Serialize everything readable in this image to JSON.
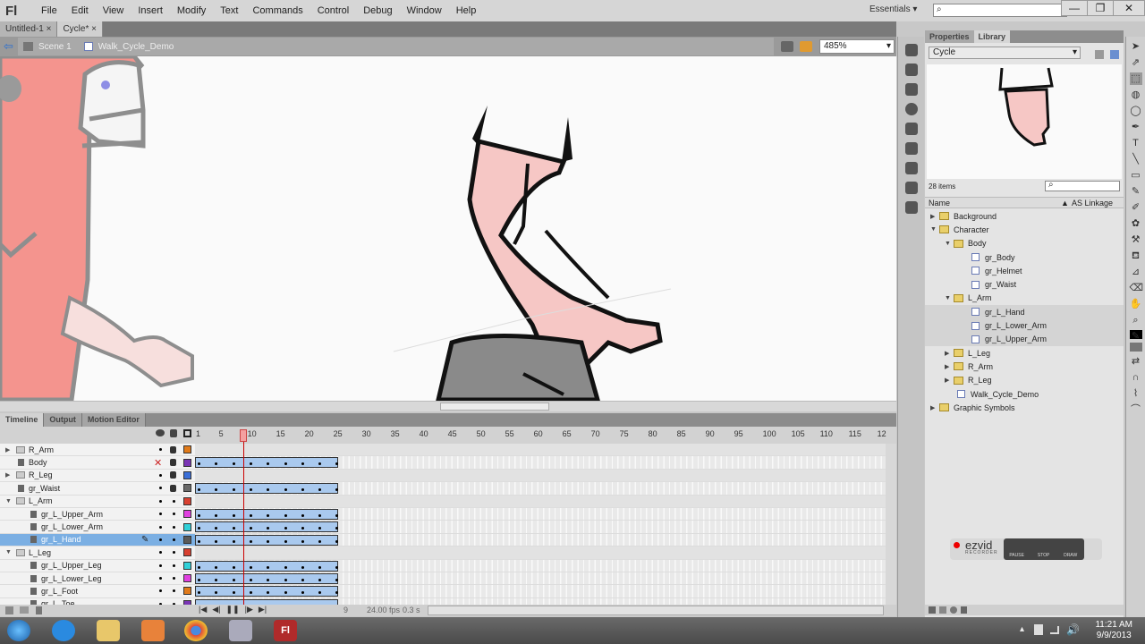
{
  "app": {
    "logo": "Fl"
  },
  "menu": [
    "File",
    "Edit",
    "View",
    "Insert",
    "Modify",
    "Text",
    "Commands",
    "Control",
    "Debug",
    "Window",
    "Help"
  ],
  "workspace": {
    "label": "Essentials",
    "chevron": "▾",
    "search_placeholder": "",
    "search_icon": "⌕"
  },
  "window_controls": {
    "minimize": "—",
    "restore": "❐",
    "close": "✕"
  },
  "doc_tabs": [
    {
      "label": "Untitled-1",
      "close": "×",
      "active": false
    },
    {
      "label": "Cycle*",
      "close": "×",
      "active": true
    }
  ],
  "edit_bar": {
    "back_icon": "⇦",
    "scene": "Scene 1",
    "symbol": "Walk_Cycle_Demo",
    "zoom": "485%",
    "zoom_chevron": "▾"
  },
  "timeline": {
    "tabs": [
      "Timeline",
      "Output",
      "Motion Editor"
    ],
    "active_tab": "Timeline",
    "header_icons": {
      "eye": "👁",
      "lock": "🔒",
      "outline": "□"
    },
    "ruler": [
      "1",
      "5",
      "10",
      "15",
      "20",
      "25",
      "30",
      "35",
      "40",
      "45",
      "50",
      "55",
      "60",
      "65",
      "70",
      "75",
      "80",
      "85",
      "90",
      "95",
      "100",
      "105",
      "110",
      "115",
      "12"
    ],
    "current_frame": 9,
    "layers": [
      {
        "name": "R_Arm",
        "type": "folder",
        "expanded": false,
        "color": "#e07a1a",
        "frames": false,
        "indent": 0
      },
      {
        "name": "Body",
        "type": "layer",
        "color": "#7a35b5",
        "frames": true,
        "indent": 0,
        "hidden": true
      },
      {
        "name": "R_Leg",
        "type": "folder",
        "expanded": false,
        "color": "#3a6fd8",
        "frames": false,
        "indent": 0
      },
      {
        "name": "gr_Waist",
        "type": "layer",
        "color": "#6a6a6a",
        "frames": true,
        "indent": 0
      },
      {
        "name": "L_Arm",
        "type": "folder",
        "expanded": true,
        "color": "#d84030",
        "frames": false,
        "indent": 0
      },
      {
        "name": "gr_L_Upper_Arm",
        "type": "layer",
        "color": "#e040e0",
        "frames": true,
        "indent": 1
      },
      {
        "name": "gr_L_Lower_Arm",
        "type": "layer",
        "color": "#30d0d8",
        "frames": true,
        "indent": 1
      },
      {
        "name": "gr_L_Hand",
        "type": "layer",
        "color": "#5a5a5a",
        "frames": true,
        "indent": 1,
        "selected": true
      },
      {
        "name": "L_Leg",
        "type": "folder",
        "expanded": true,
        "color": "#d84030",
        "frames": false,
        "indent": 0
      },
      {
        "name": "gr_L_Upper_Leg",
        "type": "layer",
        "color": "#30d0d8",
        "frames": true,
        "indent": 1
      },
      {
        "name": "gr_L_Lower_Leg",
        "type": "layer",
        "color": "#e040e0",
        "frames": true,
        "indent": 1
      },
      {
        "name": "gr_L_Foot",
        "type": "layer",
        "color": "#e07a1a",
        "frames": true,
        "indent": 1
      },
      {
        "name": "gr_L_Toe",
        "type": "layer",
        "color": "#7a35b5",
        "frames": true,
        "indent": 1
      }
    ],
    "span_frames": 25,
    "footer": {
      "frame": "9",
      "fps": "24.00 fps",
      "time": "0.3 s"
    },
    "playback": [
      "|◀",
      "◀|",
      "❚❚",
      "|▶",
      "▶|"
    ]
  },
  "library": {
    "tabs": [
      "Properties",
      "Library"
    ],
    "active_tab": "Library",
    "document": "Cycle",
    "item_count": "28 items",
    "columns": {
      "name": "Name",
      "linkage": "AS Linkage"
    },
    "items": [
      {
        "name": "Background",
        "type": "folder",
        "indent": 0,
        "expanded": false
      },
      {
        "name": "Character",
        "type": "folder",
        "indent": 0,
        "expanded": true
      },
      {
        "name": "Body",
        "type": "folder",
        "indent": 1,
        "expanded": true
      },
      {
        "name": "gr_Body",
        "type": "graphic",
        "indent": 2
      },
      {
        "name": "gr_Helmet",
        "type": "graphic",
        "indent": 2
      },
      {
        "name": "gr_Waist",
        "type": "graphic",
        "indent": 2
      },
      {
        "name": "L_Arm",
        "type": "folder",
        "indent": 1,
        "expanded": true
      },
      {
        "name": "gr_L_Hand",
        "type": "graphic",
        "indent": 2,
        "selected": true
      },
      {
        "name": "gr_L_Lower_Arm",
        "type": "graphic",
        "indent": 2,
        "selected": true
      },
      {
        "name": "gr_L_Upper_Arm",
        "type": "graphic",
        "indent": 2,
        "selected": true
      },
      {
        "name": "L_Leg",
        "type": "folder",
        "indent": 1,
        "expanded": false
      },
      {
        "name": "R_Arm",
        "type": "folder",
        "indent": 1,
        "expanded": false
      },
      {
        "name": "R_Leg",
        "type": "folder",
        "indent": 1,
        "expanded": false
      },
      {
        "name": "Walk_Cycle_Demo",
        "type": "graphic",
        "indent": 1
      },
      {
        "name": "Graphic Symbols",
        "type": "folder",
        "indent": 0,
        "expanded": false
      }
    ]
  },
  "recorder": {
    "brand": "ezvid",
    "sub": "RECORDER",
    "buttons": [
      "PAUSE",
      "STOP",
      "DRAW"
    ]
  },
  "tools": [
    "arrow",
    "subselect",
    "free-transform",
    "3d-rotation",
    "lasso",
    "pen",
    "text",
    "line",
    "rectangle",
    "pencil",
    "brush",
    "deco",
    "bone",
    "paint-bucket",
    "eyedropper",
    "eraser",
    "hand",
    "zoom",
    "stroke-color",
    "fill-color",
    "swap-colors",
    "snap",
    "smooth",
    "straighten"
  ],
  "tool_glyphs": [
    "➤",
    "⇗",
    "⬚",
    "◍",
    "◯",
    "✒",
    "T",
    "╲",
    "▭",
    "✎",
    "✐",
    "✿",
    "⚒",
    "⛾",
    "⊿",
    "⌫",
    "✋",
    "⌕",
    "✎",
    "■",
    "⇄",
    "∩",
    "⌇",
    "⌒"
  ],
  "taskbar": {
    "apps": [
      "Start",
      "Internet Explorer",
      "File Explorer",
      "Media Player",
      "Chrome",
      "Webcam",
      "Flash"
    ],
    "time": "11:21 AM",
    "date": "9/9/2013"
  },
  "colors": {
    "selection": "#7bafe3",
    "frame_span": "#a9c9ee",
    "playhead": "#cc0000",
    "jersey": "#f2726a",
    "skin": "#f6c7c5",
    "pants": "#8a8a8a"
  }
}
